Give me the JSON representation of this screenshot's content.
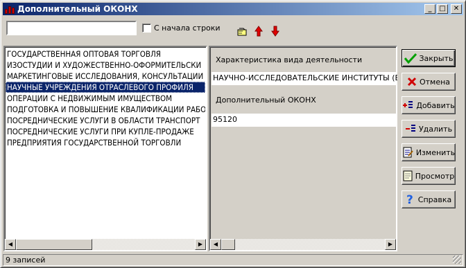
{
  "window": {
    "title": "Дополнительный ОКОНХ",
    "controls": {
      "minimize": "_",
      "maximize": "□",
      "close": "✕"
    }
  },
  "search": {
    "value": "",
    "checkbox_label": "С начала строки",
    "checked": false
  },
  "toolbar_icons": [
    "find-icon",
    "arrow-up-icon",
    "arrow-down-icon"
  ],
  "list": {
    "items": [
      "ГОСУДАРСТВЕННАЯ ОПТОВАЯ ТОРГОВЛЯ",
      "ИЗОСТУДИИ И ХУДОЖЕСТВЕННО-ОФОРМИТЕЛЬСКИ",
      "МАРКЕТИНГОВЫЕ ИССЛЕДОВАНИЯ, КОНСУЛЬТАЦИИ",
      "НАУЧНЫЕ УЧРЕЖДЕНИЯ ОТРАСЛЕВОГО ПРОФИЛЯ",
      "ОПЕРАЦИИ С НЕДВИЖИМЫМ ИМУЩЕСТВОМ",
      "ПОДГОТОВКА И ПОВЫШЕНИЕ КВАЛИФИКАЦИИ РАБО",
      "ПОСРЕДНИЧЕСКИЕ УСЛУГИ В ОБЛАСТИ ТРАНСПОРТ",
      "ПОСРЕДНИЧЕСКИЕ УСЛУГИ ПРИ КУПЛЕ-ПРОДАЖЕ",
      "ПРЕДПРИЯТИЯ ГОСУДАРСТВЕННОЙ ТОРГОВЛИ"
    ],
    "selected_index": 3
  },
  "detail": {
    "activity_label": "Характеристика вида деятельности",
    "activity_value": "НАУЧНО-ИССЛЕДОВАТЕЛЬСКИЕ ИНСТИТУТЫ (ВК",
    "okonh_label": "Дополнительный ОКОНХ",
    "okonh_value": "95120"
  },
  "buttons": {
    "close": "Закрыть",
    "cancel": "Отмена",
    "add": "Добавить",
    "delete": "Удалить",
    "edit": "Изменить",
    "view": "Просмотр",
    "help": "Справка"
  },
  "status": {
    "records": "9 записей"
  },
  "colors": {
    "selection": "#0a246a",
    "title_start": "#0a246a",
    "title_end": "#a6caf0",
    "face": "#d4d0c8"
  }
}
